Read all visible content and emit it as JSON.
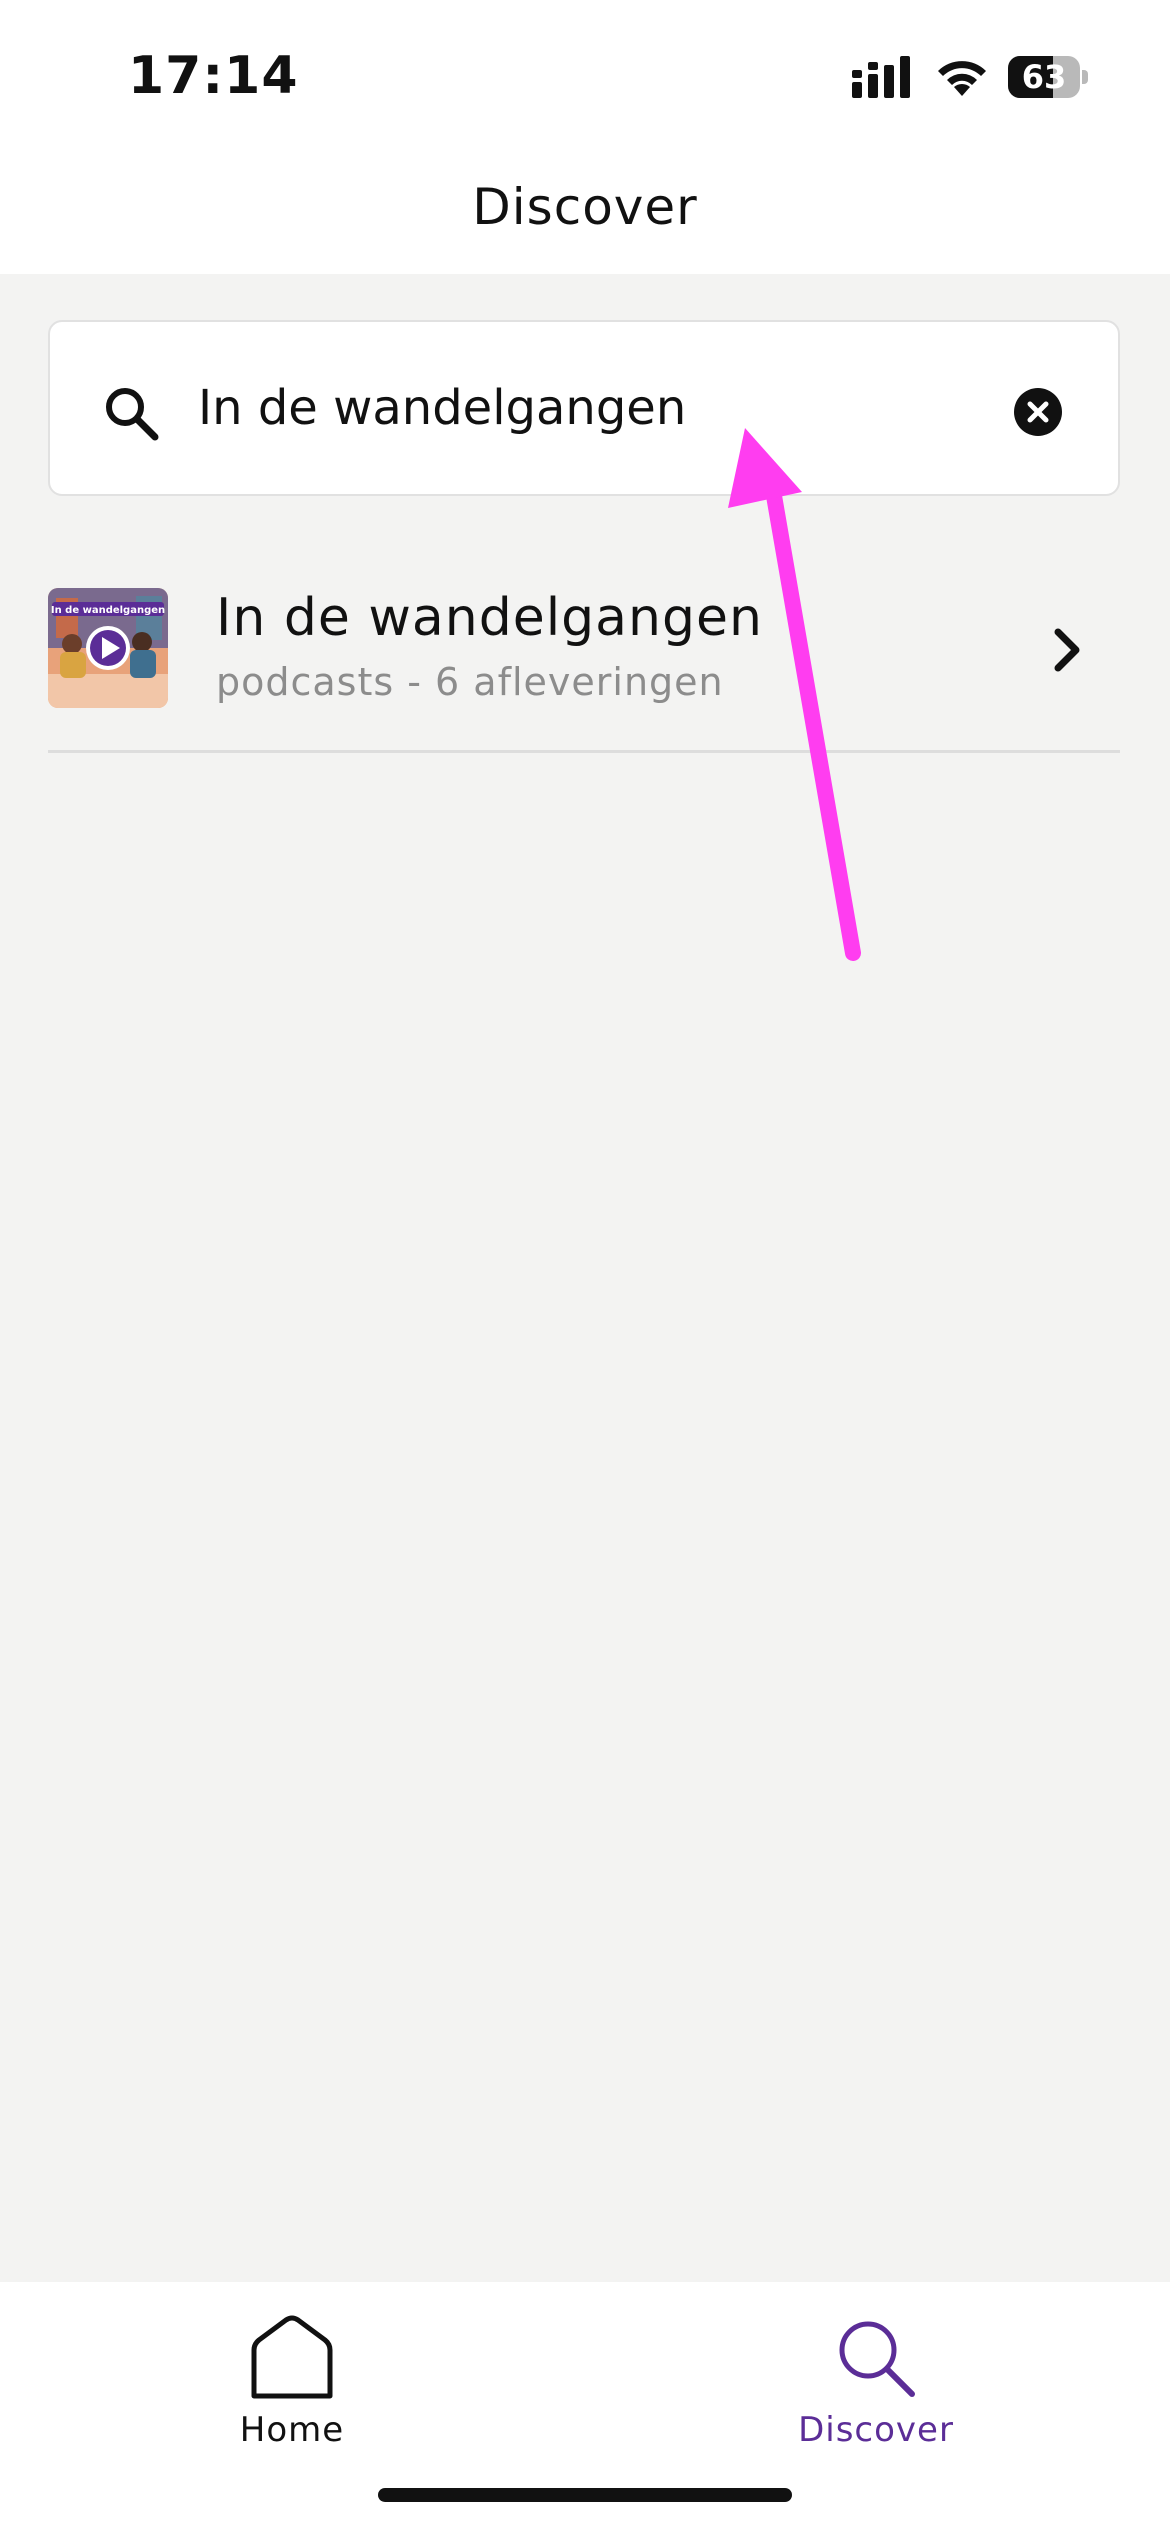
{
  "status_bar": {
    "time": "17:14",
    "battery_percent": "63",
    "battery_level": 0.63
  },
  "header": {
    "title": "Discover"
  },
  "search": {
    "value": "In de wandelgangen",
    "placeholder": ""
  },
  "results": [
    {
      "title": "In de wandelgangen",
      "subtitle": "podcasts - 6 afleveringen",
      "thumbnail_caption": "In de wandelgangen"
    }
  ],
  "tab_bar": {
    "tabs": [
      {
        "label": "Home",
        "icon": "home-icon",
        "active": false
      },
      {
        "label": "Discover",
        "icon": "search-icon",
        "active": true
      }
    ]
  },
  "colors": {
    "accent": "#5b2d97",
    "annotation_arrow": "#ff3df0",
    "background": "#f3f3f2"
  }
}
